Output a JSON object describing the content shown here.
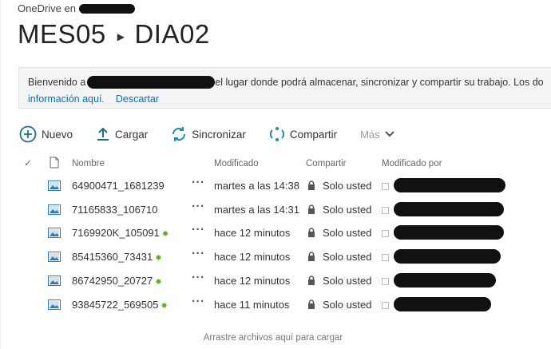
{
  "app": {
    "title": "OneDrive en"
  },
  "breadcrumb": {
    "parent": "MES05",
    "current": "DIA02"
  },
  "banner": {
    "prefix": "Bienvenido a",
    "text": "el lugar donde podrá almacenar, sincronizar y compartir su trabajo. Los do",
    "link_info": "información aquí.",
    "link_dismiss": "Descartar"
  },
  "toolbar": {
    "new_label": "Nuevo",
    "upload_label": "Cargar",
    "sync_label": "Sincronizar",
    "share_label": "Compartir",
    "more_label": "Más"
  },
  "columns": {
    "name": "Nombre",
    "modified": "Modificado",
    "sharing": "Compartir",
    "modified_by": "Modificado por"
  },
  "files": [
    {
      "name": "64900471_1681239",
      "modified": "martes a las 14:38",
      "sharing": "Solo usted",
      "is_new": false
    },
    {
      "name": "71165833_106710",
      "modified": "martes a las 14:31",
      "sharing": "Solo usted",
      "is_new": false
    },
    {
      "name": "7169920K_105091",
      "modified": "hace 12 minutos",
      "sharing": "Solo usted",
      "is_new": true
    },
    {
      "name": "85415360_73431",
      "modified": "hace 12 minutos",
      "sharing": "Solo usted",
      "is_new": true
    },
    {
      "name": "86742950_20727",
      "modified": "hace 12 minutos",
      "sharing": "Solo usted",
      "is_new": true
    },
    {
      "name": "93845722_569505",
      "modified": "hace 11 minutos",
      "sharing": "Solo usted",
      "is_new": true
    }
  ],
  "drop_message": "Arrastre archivos aquí para cargar",
  "colors": {
    "accent": "#0072c6",
    "new_badge": "#66aa22",
    "icon_blue": "#2b7bb9",
    "sync_teal": "#1a8fb3"
  },
  "icons": [
    "add-circle-icon",
    "upload-icon",
    "sync-icon",
    "share-icon",
    "chevron-down-icon",
    "checkmark-icon",
    "file-icon",
    "image-file-icon",
    "lock-icon",
    "new-star-icon"
  ]
}
